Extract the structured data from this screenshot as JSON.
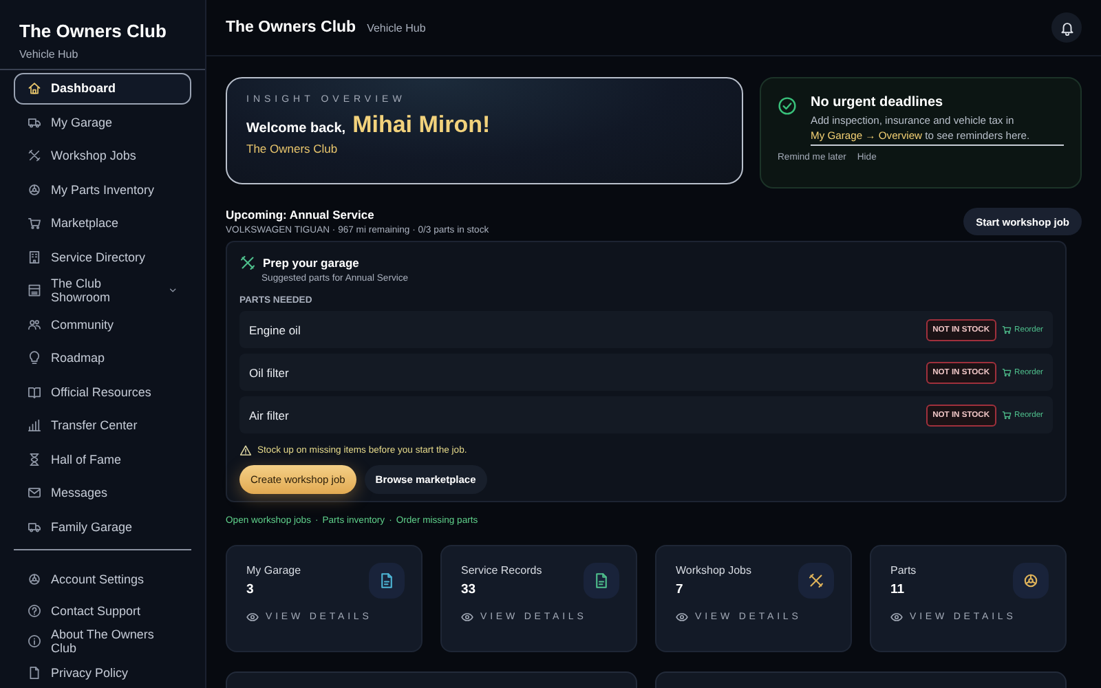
{
  "sidebar": {
    "brand": "The Owners Club",
    "subtitle": "Vehicle Hub",
    "items": [
      {
        "label": "Dashboard",
        "selected": true,
        "kind": "link"
      },
      {
        "label": "My Garage",
        "selected": false,
        "kind": "link"
      },
      {
        "label": "Workshop Jobs",
        "selected": false,
        "kind": "link"
      },
      {
        "label": "My Parts Inventory",
        "selected": false,
        "kind": "link"
      },
      {
        "label": "Marketplace",
        "selected": false,
        "kind": "link"
      },
      {
        "label": "Service Directory",
        "selected": false,
        "kind": "link"
      },
      {
        "label": "The Club Showroom",
        "selected": false,
        "kind": "group"
      },
      {
        "label": "Community",
        "selected": false,
        "kind": "link"
      },
      {
        "label": "Roadmap",
        "selected": false,
        "kind": "link"
      },
      {
        "label": "Official Resources",
        "selected": false,
        "kind": "link"
      },
      {
        "label": "Transfer Center",
        "selected": false,
        "kind": "link"
      },
      {
        "label": "Hall of Fame",
        "selected": false,
        "kind": "link"
      },
      {
        "label": "Messages",
        "selected": false,
        "kind": "link"
      },
      {
        "label": "Family Garage",
        "selected": false,
        "kind": "link"
      }
    ],
    "footer_items": [
      "Account Settings",
      "Contact Support",
      "About The Owners Club",
      "Privacy Policy"
    ]
  },
  "header": {
    "title": "The Owners Club",
    "subtitle": "Vehicle Hub"
  },
  "insight": {
    "eyebrow": "INSIGHT OVERVIEW",
    "greeting": "Welcome back,",
    "name": "Mihai Miron!",
    "club": "The Owners Club"
  },
  "deadlines": {
    "title": "No urgent deadlines",
    "text_before": "Add inspection, insurance and vehicle tax in ",
    "link": "My Garage → Overview",
    "text_after": " to see reminders here.",
    "actions": [
      "Remind me later",
      "Hide"
    ]
  },
  "upcoming": {
    "title": "Upcoming: Annual Service",
    "details": "VOLKSWAGEN TIGUAN · 967 mi remaining · 0/3 parts in stock",
    "button": "Start workshop job"
  },
  "prep": {
    "title": "Prep your garage",
    "subtitle": "Suggested parts for Annual Service",
    "section": "PARTS NEEDED",
    "parts": [
      {
        "name": "Engine oil",
        "status": "NOT IN STOCK",
        "in_stock": false,
        "action": "Reorder"
      },
      {
        "name": "Oil filter",
        "status": "NOT IN STOCK",
        "in_stock": false,
        "action": "Reorder"
      },
      {
        "name": "Air filter",
        "status": "NOT IN STOCK",
        "in_stock": false,
        "action": "Reorder"
      }
    ],
    "warning": "Stock up on missing items before you start the job.",
    "buttons": [
      {
        "label": "Create workshop job",
        "kind": "primary"
      },
      {
        "label": "Browse marketplace",
        "kind": "secondary"
      }
    ]
  },
  "quick_links": {
    "separator": "·",
    "items": [
      "Open workshop jobs",
      "Parts inventory",
      "Order missing parts"
    ]
  },
  "stats": [
    {
      "label": "My Garage",
      "value": "3",
      "action": "VIEW DETAILS",
      "color": "#4db6d6",
      "kind": "document"
    },
    {
      "label": "Service Records",
      "value": "33",
      "action": "VIEW DETAILS",
      "color": "#4fc08d",
      "kind": "document"
    },
    {
      "label": "Workshop Jobs",
      "value": "7",
      "action": "VIEW DETAILS",
      "color": "#e0b45a",
      "kind": "tools"
    },
    {
      "label": "Parts",
      "value": "11",
      "action": "VIEW DETAILS",
      "color": "#e0b45a",
      "kind": "gear"
    }
  ]
}
